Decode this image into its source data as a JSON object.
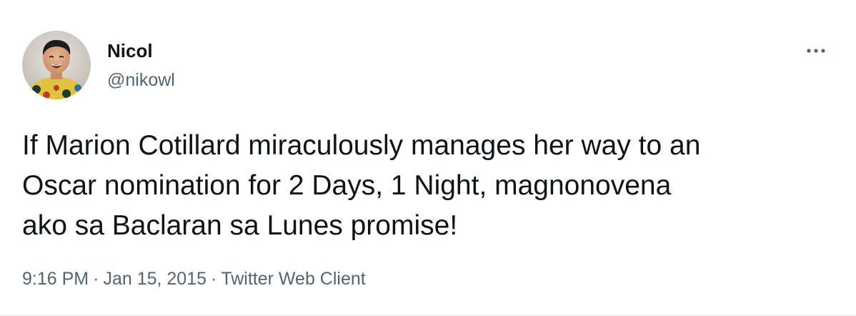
{
  "author": {
    "display_name": "Nicol",
    "handle": "@nikowl"
  },
  "more_icon": "more-horizontal-icon",
  "tweet": {
    "text_lines": [
      "If Marion Cotillard miraculously manages her way to an",
      "Oscar nomination for 2 Days, 1 Night, magnonovena",
      "ako sa Baclaran sa Lunes promise!"
    ],
    "time": "9:16 PM",
    "date": "Jan 15, 2015",
    "source": "Twitter Web Client",
    "separator": "·"
  },
  "colors": {
    "primary_text": "#0f1419",
    "secondary_text": "#536471",
    "background": "#ffffff",
    "divider": "#eff3f4"
  }
}
